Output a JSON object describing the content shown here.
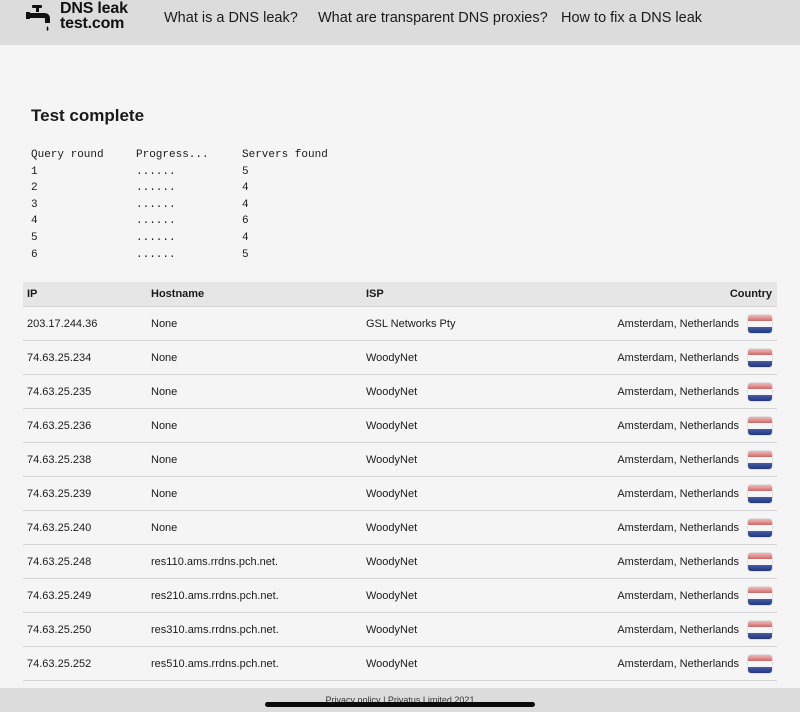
{
  "header": {
    "logo_text": "DNS leak\ntest.com",
    "nav": [
      "What is a DNS leak?",
      "What are transparent DNS proxies?",
      "How to fix a DNS leak"
    ]
  },
  "main": {
    "title": "Test complete",
    "progress": {
      "headers": [
        "Query round",
        "Progress...",
        "Servers found"
      ],
      "rows": [
        [
          "1",
          "......",
          "5"
        ],
        [
          "2",
          "......",
          "4"
        ],
        [
          "3",
          "......",
          "4"
        ],
        [
          "4",
          "......",
          "6"
        ],
        [
          "5",
          "......",
          "4"
        ],
        [
          "6",
          "......",
          "5"
        ]
      ]
    },
    "results": {
      "headers": [
        "IP",
        "Hostname",
        "ISP",
        "Country"
      ],
      "rows": [
        [
          "203.17.244.36",
          "None",
          "GSL Networks Pty",
          "Amsterdam, Netherlands"
        ],
        [
          "74.63.25.234",
          "None",
          "WoodyNet",
          "Amsterdam, Netherlands"
        ],
        [
          "74.63.25.235",
          "None",
          "WoodyNet",
          "Amsterdam, Netherlands"
        ],
        [
          "74.63.25.236",
          "None",
          "WoodyNet",
          "Amsterdam, Netherlands"
        ],
        [
          "74.63.25.238",
          "None",
          "WoodyNet",
          "Amsterdam, Netherlands"
        ],
        [
          "74.63.25.239",
          "None",
          "WoodyNet",
          "Amsterdam, Netherlands"
        ],
        [
          "74.63.25.240",
          "None",
          "WoodyNet",
          "Amsterdam, Netherlands"
        ],
        [
          "74.63.25.248",
          "res110.ams.rrdns.pch.net.",
          "WoodyNet",
          "Amsterdam, Netherlands"
        ],
        [
          "74.63.25.249",
          "res210.ams.rrdns.pch.net.",
          "WoodyNet",
          "Amsterdam, Netherlands"
        ],
        [
          "74.63.25.250",
          "res310.ams.rrdns.pch.net.",
          "WoodyNet",
          "Amsterdam, Netherlands"
        ],
        [
          "74.63.25.252",
          "res510.ams.rrdns.pch.net.",
          "WoodyNet",
          "Amsterdam, Netherlands"
        ]
      ],
      "flag_icon": "netherlands-flag-icon"
    }
  },
  "footer": {
    "text": "Privacy policy | Privatus Limited 2021"
  },
  "colors": {
    "header_bg": "#dcdcdc",
    "page_bg": "#f5f5f5",
    "table_header_bg": "#e6e6e6",
    "flag_red": "#c84848",
    "flag_white": "#f7f7f7",
    "flag_blue": "#23398a"
  }
}
